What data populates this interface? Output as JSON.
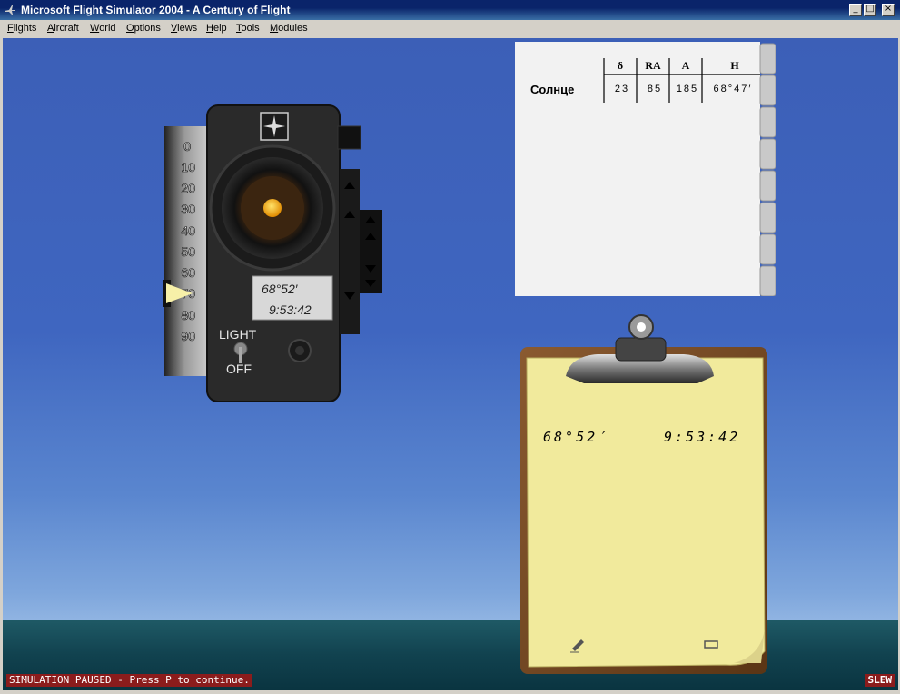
{
  "window": {
    "title": "Microsoft Flight Simulator 2004 - A Century of Flight",
    "icon": "airplane-icon"
  },
  "menu": [
    {
      "acc": "F",
      "rest": "lights"
    },
    {
      "acc": "A",
      "rest": "ircraft"
    },
    {
      "acc": "W",
      "rest": "orld"
    },
    {
      "acc": "O",
      "rest": "ptions"
    },
    {
      "acc": "V",
      "rest": "iews"
    },
    {
      "acc": "H",
      "rest": "elp"
    },
    {
      "acc": "T",
      "rest": "ools"
    },
    {
      "acc": "M",
      "rest": "odules"
    }
  ],
  "sextant": {
    "scale": [
      "0",
      "10",
      "20",
      "30",
      "40",
      "50",
      "60",
      "70",
      "80",
      "90"
    ],
    "angle": "68°52′",
    "time": "9:53:42",
    "light_label": "LIGHT",
    "off_label": "OFF"
  },
  "sight_table": {
    "headers": [
      "δ",
      "RA",
      "A",
      "H"
    ],
    "row_label": "Солнце",
    "values": [
      "23",
      "85",
      "185",
      "68°47′"
    ]
  },
  "clipboard": {
    "angle": "68°52′",
    "time": "9:53:42"
  },
  "status": {
    "paused": "SIMULATION PAUSED - Press P to continue.",
    "slew": "SLEW"
  }
}
